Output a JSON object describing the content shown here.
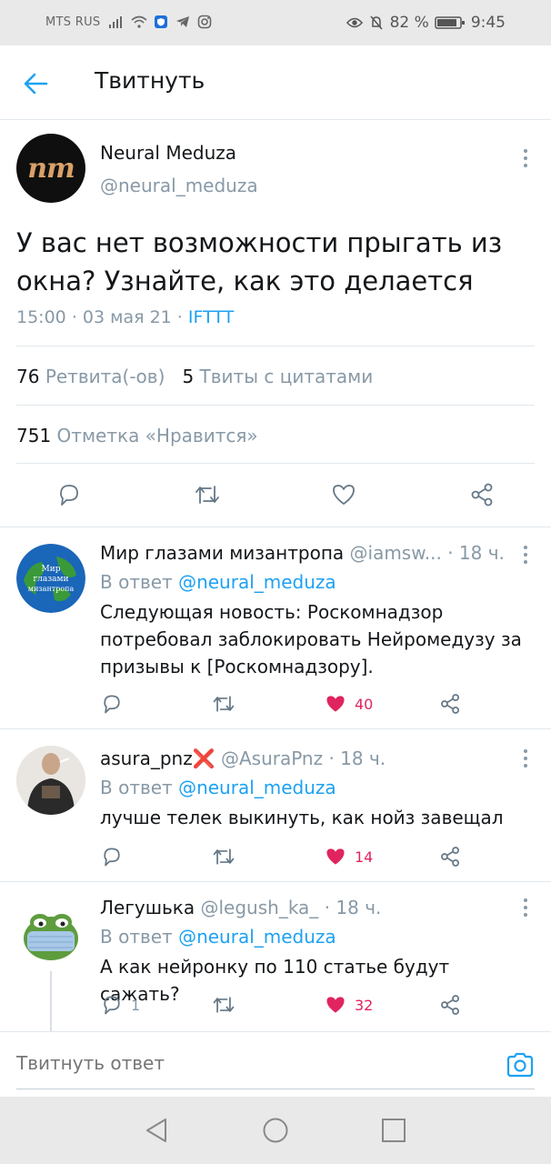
{
  "status_bar": {
    "carrier": "MTS RUS",
    "battery": "82 %",
    "time": "9:45",
    "icons": [
      "signal-icon",
      "wifi-icon",
      "shield-app-icon",
      "telegram-icon",
      "instagram-icon",
      "eye-icon",
      "alarm-off-icon",
      "battery-icon"
    ]
  },
  "header": {
    "title": "Твитнуть",
    "back_icon": "arrow-left-icon"
  },
  "tweet": {
    "avatar_text": "nm",
    "name": "Neural Meduza",
    "handle": "@neural_meduza",
    "text": "У вас нет возможности прыгать из окна? Узнайте, как это делается",
    "time": "15:00",
    "date": "03 мая 21",
    "source": "IFTTT",
    "sep": "·",
    "retweets_count": "76",
    "retweets_label": "Ретвита(-ов)",
    "quotes_count": "5",
    "quotes_label": "Твиты с цитатами",
    "likes_count": "751",
    "likes_label": "Отметка «Нравится»",
    "actions": [
      "reply-icon",
      "retweet-icon",
      "like-icon",
      "share-icon"
    ]
  },
  "replies": [
    {
      "avatar_text": "Мир глазами мизантропа",
      "name": "Мир глазами мизантропа",
      "handle": "@iamsw...",
      "age": "· 18 ч.",
      "in_reply_label": "В ответ",
      "in_reply_to": "@neural_meduza",
      "text": "Следующая новость: Роскомнадзор потребовал заблокировать Нейромедузу за призывы к [Роскомнадзору].",
      "replies": "",
      "likes": "40",
      "liked": true
    },
    {
      "name": "asura_pnz",
      "name_emoji": "❌",
      "handle": "@AsuraPnz",
      "age": "· 18 ч.",
      "in_reply_label": "В ответ",
      "in_reply_to": "@neural_meduza",
      "text": "лучше телек выкинуть, как нойз завещал",
      "replies": "",
      "likes": "14",
      "liked": true
    },
    {
      "name": "Легушька",
      "handle": "@legush_ka_",
      "age": "· 18 ч.",
      "in_reply_label": "В ответ",
      "in_reply_to": "@neural_meduza",
      "text": "А как нейронку по 110 статье будут сажать?",
      "replies": "1",
      "likes": "32",
      "liked": true
    }
  ],
  "reply_box": {
    "placeholder": "Твитнуть ответ",
    "camera_icon": "camera-icon"
  },
  "nav_bar": {
    "icons": [
      "nav-back-icon",
      "nav-home-icon",
      "nav-recents-icon"
    ]
  },
  "colors": {
    "accent": "#1da1f2",
    "like": "#e0245e",
    "muted": "#8899a6",
    "text": "#14171a"
  }
}
